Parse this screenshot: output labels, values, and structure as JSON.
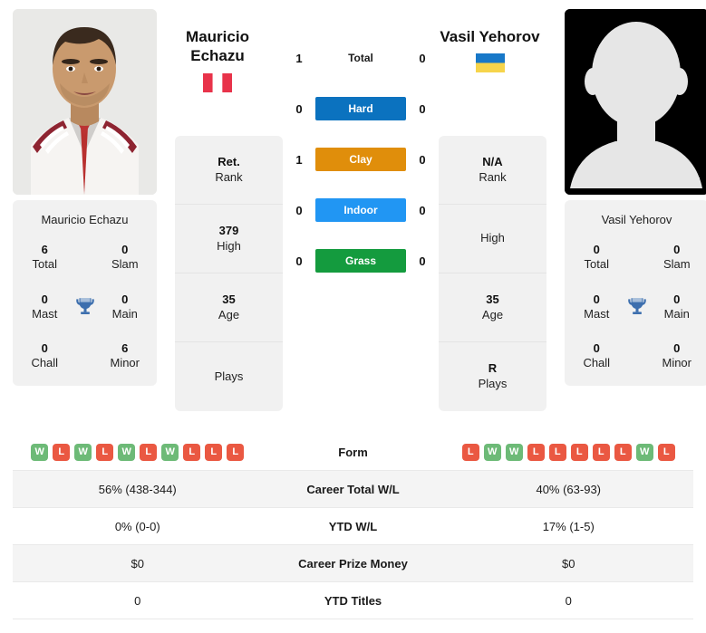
{
  "players": {
    "left": {
      "name_line1": "Mauricio",
      "name_line2": "Echazu",
      "full_name": "Mauricio Echazu",
      "flag_name": "peru-flag",
      "photo_type": "photo",
      "titles": {
        "total_value": "6",
        "total_label": "Total",
        "slam_value": "0",
        "slam_label": "Slam",
        "mast_value": "0",
        "mast_label": "Mast",
        "main_value": "0",
        "main_label": "Main",
        "chall_value": "0",
        "chall_label": "Chall",
        "minor_value": "6",
        "minor_label": "Minor"
      },
      "ranks": [
        {
          "value": "Ret.",
          "label": "Rank"
        },
        {
          "value": "379",
          "label": "High"
        },
        {
          "value": "35",
          "label": "Age"
        },
        {
          "value": "",
          "label": "Plays"
        }
      ],
      "form": [
        "W",
        "L",
        "W",
        "L",
        "W",
        "L",
        "W",
        "L",
        "L",
        "L"
      ],
      "career_total_wl": "56% (438-344)",
      "ytd_wl": "0% (0-0)",
      "career_prize_money": "$0",
      "ytd_titles": "0"
    },
    "right": {
      "name_line1": "Vasil Yehorov",
      "name_line2": "",
      "full_name": "Vasil Yehorov",
      "flag_name": "ukraine-flag",
      "photo_type": "placeholder-silhouette",
      "titles": {
        "total_value": "0",
        "total_label": "Total",
        "slam_value": "0",
        "slam_label": "Slam",
        "mast_value": "0",
        "mast_label": "Mast",
        "main_value": "0",
        "main_label": "Main",
        "chall_value": "0",
        "chall_label": "Chall",
        "minor_value": "0",
        "minor_label": "Minor"
      },
      "ranks": [
        {
          "value": "N/A",
          "label": "Rank"
        },
        {
          "value": "",
          "label": "High"
        },
        {
          "value": "35",
          "label": "Age"
        },
        {
          "value": "R",
          "label": "Plays"
        }
      ],
      "form": [
        "L",
        "W",
        "W",
        "L",
        "L",
        "L",
        "L",
        "L",
        "W",
        "L"
      ],
      "career_total_wl": "40% (63-93)",
      "ytd_wl": "17% (1-5)",
      "career_prize_money": "$0",
      "ytd_titles": "0"
    }
  },
  "h2h": [
    {
      "label": "Total",
      "left": "1",
      "right": "0",
      "style": "plain",
      "color": ""
    },
    {
      "label": "Hard",
      "left": "0",
      "right": "0",
      "style": "badge",
      "color": "#0b72bf"
    },
    {
      "label": "Clay",
      "left": "1",
      "right": "0",
      "style": "badge",
      "color": "#e08e0b"
    },
    {
      "label": "Indoor",
      "left": "0",
      "right": "0",
      "style": "badge",
      "color": "#2196f3"
    },
    {
      "label": "Grass",
      "left": "0",
      "right": "0",
      "style": "badge",
      "color": "#149b3e"
    }
  ],
  "table": {
    "rows": [
      {
        "label": "Form",
        "type": "form"
      },
      {
        "label": "Career Total W/L",
        "type": "text",
        "key": "career_total_wl"
      },
      {
        "label": "YTD W/L",
        "type": "text",
        "key": "ytd_wl"
      },
      {
        "label": "Career Prize Money",
        "type": "text",
        "key": "career_prize_money"
      },
      {
        "label": "YTD Titles",
        "type": "text",
        "key": "ytd_titles"
      }
    ]
  },
  "colors": {
    "hard": "#0b72bf",
    "clay": "#e08e0b",
    "indoor": "#2196f3",
    "grass": "#149b3e",
    "win": "#6dba77",
    "loss": "#ea5842",
    "card_bg": "#f1f1f1",
    "row_alt": "#f4f4f4"
  }
}
